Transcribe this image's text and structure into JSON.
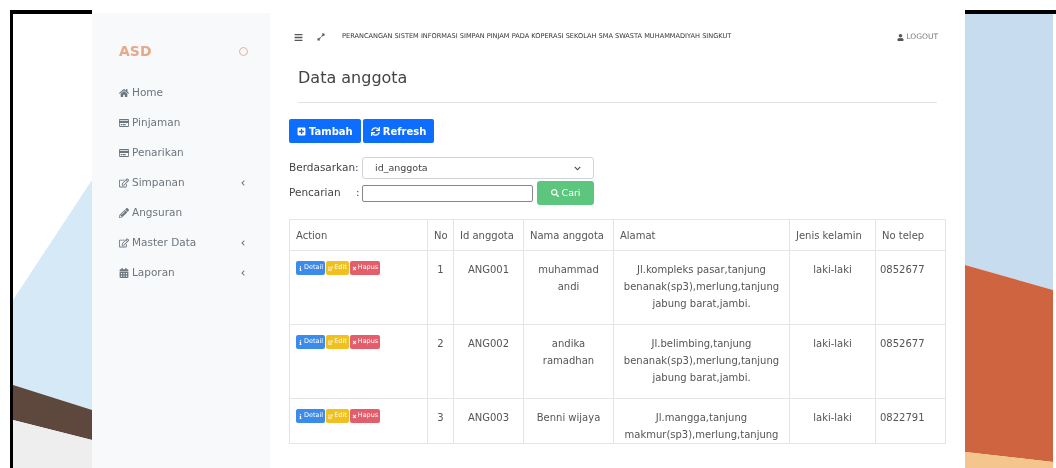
{
  "sidebar": {
    "brand": "ASD",
    "items": [
      {
        "label": "Home",
        "has_submenu": false
      },
      {
        "label": "Pinjaman",
        "has_submenu": false
      },
      {
        "label": "Penarikan",
        "has_submenu": false
      },
      {
        "label": "Simpanan",
        "has_submenu": true
      },
      {
        "label": "Angsuran",
        "has_submenu": false
      },
      {
        "label": "Master Data",
        "has_submenu": true
      },
      {
        "label": "Laporan",
        "has_submenu": true
      }
    ]
  },
  "header": {
    "title": "PERANCANGAN SISTEM INFORMASI SIMPAN PINJAM PADA KOPERASI SEKOLAH SMA SWASTA MUHAMMADIYAH SINGKUT",
    "logout": "LOGOUT"
  },
  "page_title": "Data anggota",
  "buttons": [
    {
      "label": "Tambah"
    },
    {
      "label": "Refresh"
    }
  ],
  "filter": {
    "label": "Berdasarkan:",
    "value": "id_anggota"
  },
  "search": {
    "label": "Pencarian",
    "separator": ":",
    "button": "Cari"
  },
  "table": {
    "action_column": "Action",
    "columns": [
      "No",
      "Id anggota",
      "Nama anggota",
      "Alamat",
      "Jenis kelamin",
      "No telep"
    ],
    "rows": [
      {
        "actions": [
          {
            "kind": "detail",
            "label": "Detail"
          },
          {
            "kind": "edit",
            "label": "Edit"
          },
          {
            "kind": "delete",
            "label": "Hapus"
          }
        ],
        "cells": [
          "1",
          "ANG001",
          "muhammad andi",
          "Jl.kompleks pasar,tanjung benanak(sp3),merlung,tanjung jabung barat,jambi.",
          "laki-laki",
          "0852677"
        ]
      },
      {
        "actions": [
          {
            "kind": "detail",
            "label": "Detail"
          },
          {
            "kind": "edit",
            "label": "Edit"
          },
          {
            "kind": "delete",
            "label": "Hapus"
          }
        ],
        "cells": [
          "2",
          "ANG002",
          "andika ramadhan",
          "Jl.belimbing,tanjung benanak(sp3),merlung,tanjung jabung barat,jambi.",
          "laki-laki",
          "0852677"
        ]
      },
      {
        "actions": [
          {
            "kind": "detail",
            "label": "Detail"
          },
          {
            "kind": "edit",
            "label": "Edit"
          },
          {
            "kind": "delete",
            "label": "Hapus"
          }
        ],
        "cells": [
          "3",
          "ANG003",
          "Benni wijaya",
          "Jl.mangga,tanjung makmur(sp3),merlung,tanjung",
          "laki-laki",
          "0822791"
        ]
      }
    ]
  }
}
